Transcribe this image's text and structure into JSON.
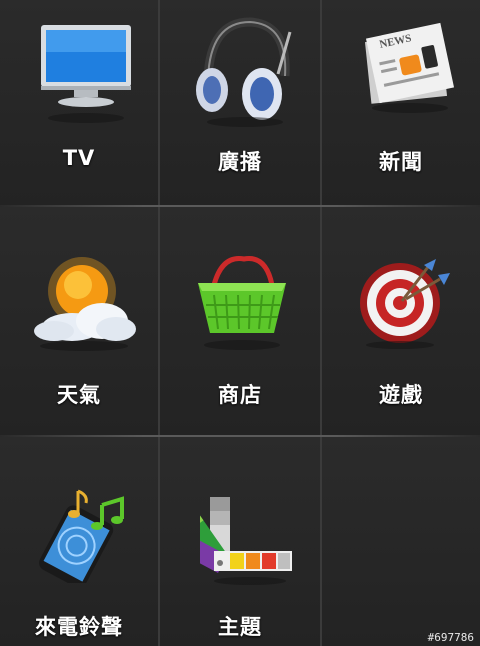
{
  "menu": {
    "items": [
      {
        "label": "TV",
        "icon": "tv-icon"
      },
      {
        "label": "廣播",
        "icon": "headphones-icon"
      },
      {
        "label": "新聞",
        "icon": "newspaper-icon"
      },
      {
        "label": "天氣",
        "icon": "weather-icon"
      },
      {
        "label": "商店",
        "icon": "shopping-basket-icon"
      },
      {
        "label": "遊戲",
        "icon": "dartboard-icon"
      },
      {
        "label": "來電鈴聲",
        "icon": "ringtone-phone-icon"
      },
      {
        "label": "主題",
        "icon": "color-swatch-icon"
      }
    ]
  },
  "icon_text": {
    "news_masthead": "NEWS"
  },
  "watermark": "#697786",
  "colors": {
    "background": "#242424",
    "divider": "#4a4a4a",
    "label": "#ffffff"
  }
}
